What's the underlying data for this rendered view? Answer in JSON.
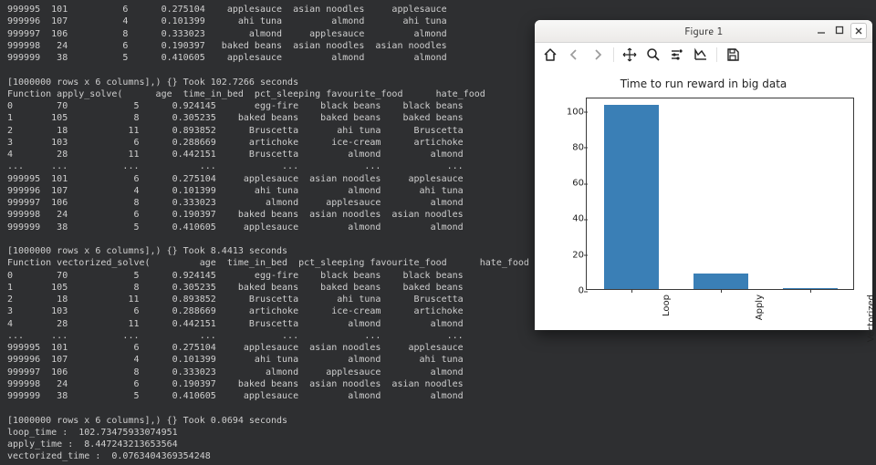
{
  "terminal": {
    "lines": [
      "999995  101          6      0.275104    applesauce  asian noodles     applesauce",
      "999996  107          4      0.101399      ahi tuna         almond       ahi tuna",
      "999997  106          8      0.333023        almond     applesauce         almond",
      "999998   24          6      0.190397   baked beans  asian noodles  asian noodles",
      "999999   38          5      0.410605    applesauce         almond         almond",
      "",
      "[1000000 rows x 6 columns],) {} Took 102.7266 seconds",
      "Function apply_solve(      age  time_in_bed  pct_sleeping favourite_food      hate_food         reward",
      "0        70            5      0.924145       egg-fire    black beans    black beans",
      "1       105            8      0.305235    baked beans    baked beans    baked beans",
      "2        18           11      0.893852      Bruscetta       ahi tuna      Bruscetta",
      "3       103            6      0.288669      artichoke      ice-cream      artichoke",
      "4        28           11      0.442151      Bruscetta         almond         almond",
      "...     ...          ...           ...            ...            ...            ...",
      "999995  101            6      0.275104     applesauce  asian noodles     applesauce",
      "999996  107            4      0.101399       ahi tuna         almond       ahi tuna",
      "999997  106            8      0.333023         almond     applesauce         almond",
      "999998   24            6      0.190397    baked beans  asian noodles  asian noodles",
      "999999   38            5      0.410605     applesauce         almond         almond",
      "",
      "[1000000 rows x 6 columns],) {} Took 8.4413 seconds",
      "Function vectorized_solve(         age  time_in_bed  pct_sleeping favourite_food      hate_food         reward",
      "0        70            5      0.924145       egg-fire    black beans    black beans",
      "1       105            8      0.305235    baked beans    baked beans    baked beans",
      "2        18           11      0.893852      Bruscetta       ahi tuna      Bruscetta",
      "3       103            6      0.288669      artichoke      ice-cream      artichoke",
      "4        28           11      0.442151      Bruscetta         almond         almond",
      "...     ...          ...           ...            ...            ...            ...",
      "999995  101            6      0.275104     applesauce  asian noodles     applesauce",
      "999996  107            4      0.101399       ahi tuna         almond       ahi tuna",
      "999997  106            8      0.333023         almond     applesauce         almond",
      "999998   24            6      0.190397    baked beans  asian noodles  asian noodles",
      "999999   38            5      0.410605     applesauce         almond         almond",
      "",
      "[1000000 rows x 6 columns],) {} Took 0.0694 seconds",
      "loop_time :  102.73475933074951",
      "apply_time :  8.447243213653564",
      "vectorized_time :  0.0763404369354248"
    ]
  },
  "figure": {
    "window_title": "Figure 1"
  },
  "chart_data": {
    "type": "bar",
    "title": "Time to run reward in big data",
    "categories": [
      "Loop",
      "Apply",
      "Vectorized"
    ],
    "values": [
      102.73,
      8.45,
      0.08
    ],
    "ylabel": "",
    "xlabel": "",
    "ylim": [
      0,
      108
    ],
    "yticks": [
      0,
      20,
      40,
      60,
      80,
      100
    ],
    "bar_color": "#3a7fb6"
  }
}
